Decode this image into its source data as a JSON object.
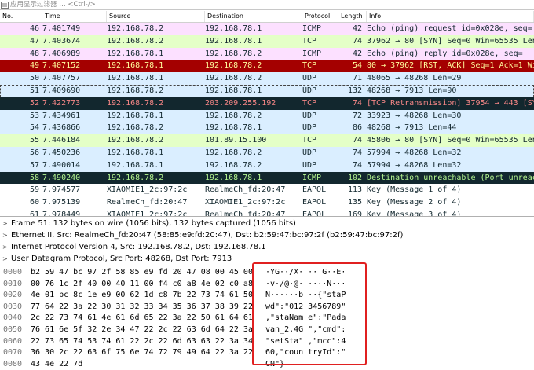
{
  "filter": {
    "placeholder": "应用显示过滤器 … <Ctrl-/>"
  },
  "columns": [
    "No.",
    "Time",
    "Source",
    "Destination",
    "Protocol",
    "Length",
    "Info"
  ],
  "packets": [
    {
      "no": "46",
      "time": "7.401749",
      "src": "192.168.78.2",
      "dst": "192.168.78.1",
      "proto": "ICMP",
      "len": "42",
      "info": "Echo (ping) request  id=0x028e, seq=",
      "bg": "#fce0ff",
      "fg": "#12272e"
    },
    {
      "no": "47",
      "time": "7.403674",
      "src": "192.168.78.2",
      "dst": "192.168.78.1",
      "proto": "TCP",
      "len": "74",
      "info": "37962 → 80 [SYN] Seq=0 Win=65535 Len",
      "bg": "#e4ffc7",
      "fg": "#12272e"
    },
    {
      "no": "48",
      "time": "7.406989",
      "src": "192.168.78.1",
      "dst": "192.168.78.2",
      "proto": "ICMP",
      "len": "42",
      "info": "Echo (ping) reply    id=0x028e, seq=",
      "bg": "#fce0ff",
      "fg": "#12272e"
    },
    {
      "no": "49",
      "time": "7.407152",
      "src": "192.168.78.1",
      "dst": "192.168.78.2",
      "proto": "TCP",
      "len": "54",
      "info": "80 → 37962 [RST, ACK] Seq=1 Ack=1 Wi",
      "bg": "#a40000",
      "fg": "#fffc9c"
    },
    {
      "no": "50",
      "time": "7.407757",
      "src": "192.168.78.1",
      "dst": "192.168.78.2",
      "proto": "UDP",
      "len": "71",
      "info": "48065 → 48268 Len=29",
      "bg": "#daeeff",
      "fg": "#12272e"
    },
    {
      "no": "51",
      "time": "7.409690",
      "src": "192.168.78.2",
      "dst": "192.168.78.1",
      "proto": "UDP",
      "len": "132",
      "info": "48268 → 7913 Len=90",
      "bg": "#daeeff",
      "fg": "#12272e",
      "outline": true
    },
    {
      "no": "52",
      "time": "7.422773",
      "src": "192.168.78.2",
      "dst": "203.209.255.192",
      "proto": "TCP",
      "len": "74",
      "info": "[TCP Retransmission] 37954 → 443 [SY",
      "bg": "#12272e",
      "fg": "#f78787"
    },
    {
      "no": "53",
      "time": "7.434961",
      "src": "192.168.78.1",
      "dst": "192.168.78.2",
      "proto": "UDP",
      "len": "72",
      "info": "33923 → 48268 Len=30",
      "bg": "#daeeff",
      "fg": "#12272e"
    },
    {
      "no": "54",
      "time": "7.436866",
      "src": "192.168.78.2",
      "dst": "192.168.78.1",
      "proto": "UDP",
      "len": "86",
      "info": "48268 → 7913 Len=44",
      "bg": "#daeeff",
      "fg": "#12272e"
    },
    {
      "no": "55",
      "time": "7.446184",
      "src": "192.168.78.2",
      "dst": "101.89.15.100",
      "proto": "TCP",
      "len": "74",
      "info": "45806 → 80 [SYN] Seq=0 Win=65535 Len",
      "bg": "#e4ffc7",
      "fg": "#12272e"
    },
    {
      "no": "56",
      "time": "7.450236",
      "src": "192.168.78.1",
      "dst": "192.168.78.2",
      "proto": "UDP",
      "len": "74",
      "info": "57994 → 48268 Len=32",
      "bg": "#daeeff",
      "fg": "#12272e"
    },
    {
      "no": "57",
      "time": "7.490014",
      "src": "192.168.78.1",
      "dst": "192.168.78.2",
      "proto": "UDP",
      "len": "74",
      "info": "57994 → 48268 Len=32",
      "bg": "#daeeff",
      "fg": "#12272e"
    },
    {
      "no": "58",
      "time": "7.490240",
      "src": "192.168.78.2",
      "dst": "192.168.78.1",
      "proto": "ICMP",
      "len": "102",
      "info": "Destination unreachable (Port unreac",
      "bg": "#12272e",
      "fg": "#b5f590"
    },
    {
      "no": "59",
      "time": "7.974577",
      "src": "XIAOMIE1_2c:97:2c",
      "dst": "RealmeCh_fd:20:47",
      "proto": "EAPOL",
      "len": "113",
      "info": "Key (Message 1 of 4)",
      "bg": "#ffffff",
      "fg": "#12272e"
    },
    {
      "no": "60",
      "time": "7.975139",
      "src": "RealmeCh_fd:20:47",
      "dst": "XIAOMIE1_2c:97:2c",
      "proto": "EAPOL",
      "len": "135",
      "info": "Key (Message 2 of 4)",
      "bg": "#ffffff",
      "fg": "#12272e"
    },
    {
      "no": "61",
      "time": "7.978449",
      "src": "XIAOMIE1_2c:97:2c",
      "dst": "RealmeCh_fd:20:47",
      "proto": "EAPOL",
      "len": "169",
      "info": "Key (Message 3 of 4)",
      "bg": "#ffffff",
      "fg": "#12272e"
    },
    {
      "no": "62",
      "time": "7.979596",
      "src": "RealmeCh_fd:20:47",
      "dst": "XIAOMIE1_2c:97:2c",
      "proto": "EAPOL",
      "len": "113",
      "info": "Key (Message 4 of 4)",
      "bg": "#ffffff",
      "fg": "#12272e"
    }
  ],
  "details": [
    "Frame 51: 132 bytes on wire (1056 bits), 132 bytes captured (1056 bits)",
    "Ethernet II, Src: RealmeCh_fd:20:47 (58:85:e9:fd:20:47), Dst: b2:59:47:bc:97:2f (b2:59:47:bc:97:2f)",
    "Internet Protocol Version 4, Src: 192.168.78.2, Dst: 192.168.78.1",
    "User Datagram Protocol, Src Port: 48268, Dst Port: 7913"
  ],
  "hexdump": [
    {
      "off": "0000",
      "hex": "b2 59 47 bc 97 2f 58 85  e9 fd 20 47 08 00 45 00",
      "ascii": "·YG··/X· ·· G··E·"
    },
    {
      "off": "0010",
      "hex": "00 76 1c 2f 40 00 40 11  00 f4 c0 a8 4e 02 c0 a8",
      "ascii": "·v·/@·@· ····N···"
    },
    {
      "off": "0020",
      "hex": "4e 01 bc 8c 1e e9 00 62  1d c8 7b 22 73 74 61 50",
      "ascii": "N······b ··{\"staP"
    },
    {
      "off": "0030",
      "hex": "77 64 22 3a 22 30 31 32  33 34 35 36 37 38 39 22",
      "ascii": "wd\":\"012 3456789\""
    },
    {
      "off": "0040",
      "hex": "2c 22 73 74 61 4e 61 6d  65 22 3a 22 50 61 64 61",
      "ascii": ",\"staNam e\":\"Pada"
    },
    {
      "off": "0050",
      "hex": "76 61 6e 5f 32 2e 34 47  22 2c 22 63 6d 64 22 3a",
      "ascii": "van_2.4G \",\"cmd\":"
    },
    {
      "off": "0060",
      "hex": "22 73 65 74 53 74 61 22  2c 22 6d 63 63 22 3a 34",
      "ascii": "\"setSta\" ,\"mcc\":4"
    },
    {
      "off": "0070",
      "hex": "36 30 2c 22 63 6f 75 6e  74 72 79 49 64 22 3a 22",
      "ascii": "60,\"coun tryId\":\""
    },
    {
      "off": "0080",
      "hex": "43 4e 22 7d",
      "ascii": "CN\"}"
    }
  ]
}
